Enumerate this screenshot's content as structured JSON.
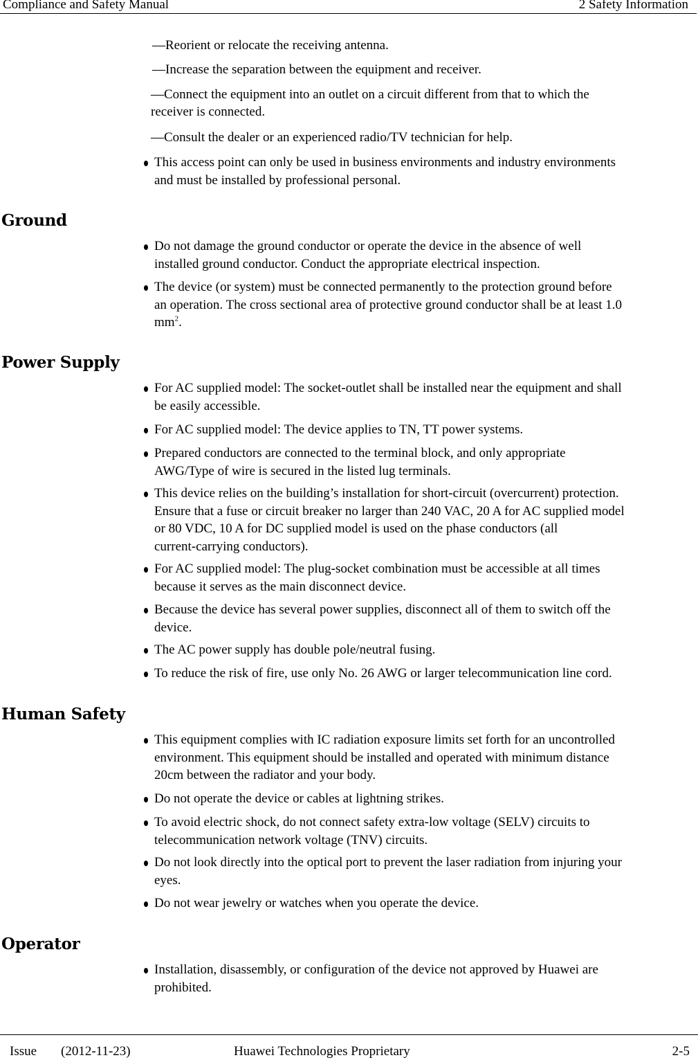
{
  "header": {
    "document_title": "Compliance and Safety Manual",
    "chapter_title": "2 Safety Information"
  },
  "continued_items": [
    {
      "dash": "—",
      "text": "Reorient or relocate the receiving antenna."
    },
    {
      "dash": "—",
      "text": "Increase the separation between the equipment and receiver."
    },
    {
      "dash": "—",
      "text": "Connect the equipment into an outlet on a circuit different from that to which the",
      "text2": "receiver is connected."
    },
    {
      "dash": "—",
      "text": "Consult the dealer or an experienced radio/TV technician for help."
    }
  ],
  "intro_bullets": [
    {
      "lines": [
        "This access point can only be used in business environments and industry environments",
        "and must be installed by professional personal."
      ]
    }
  ],
  "sections": [
    {
      "title": "Ground",
      "bullets": [
        {
          "lines": [
            "Do not damage the ground conductor or operate the device in the absence of well",
            "installed ground conductor. Conduct the appropriate electrical inspection."
          ]
        },
        {
          "lines": [
            "The device (or system) must be connected permanently to the protection ground before",
            "an operation. The cross sectional area of protective ground conductor shall be at least 1.0",
            "mm"
          ],
          "superscript": "2",
          "tail": "."
        }
      ]
    },
    {
      "title": "Power Supply",
      "bullets": [
        {
          "lines": [
            "For AC supplied model: The socket-outlet shall be installed near the equipment and shall",
            "be easily accessible."
          ]
        },
        {
          "lines": [
            "For AC supplied model: The device applies to TN, TT power systems."
          ]
        },
        {
          "lines": [
            "Prepared conductors are connected to the terminal block, and only appropriate",
            "AWG/Type of wire is secured in the listed lug terminals."
          ]
        },
        {
          "lines": [
            "This device relies on the building’s installation for short-circuit (overcurrent) protection.",
            "Ensure that a fuse or circuit breaker no larger than 240 VAC, 20 A for AC supplied model",
            "or 80 VDC, 10 A for DC supplied model is used on the phase conductors (all",
            "current-carrying conductors)."
          ]
        },
        {
          "lines": [
            "For AC supplied model: The plug-socket combination must be accessible at all times",
            "because it serves as the main disconnect device."
          ]
        },
        {
          "lines": [
            "Because the device has several power supplies, disconnect all of them to switch off the",
            "device."
          ]
        },
        {
          "lines": [
            "The AC power supply has double pole/neutral fusing."
          ]
        },
        {
          "lines": [
            "To reduce the risk of fire, use only No. 26 AWG or larger telecommunication line cord."
          ]
        }
      ]
    },
    {
      "title": "Human Safety",
      "bullets": [
        {
          "lines": [
            "This equipment complies with IC radiation exposure limits set forth for an uncontrolled",
            "environment. This equipment should be installed and operated with minimum distance",
            "20cm between the radiator and your body."
          ]
        },
        {
          "lines": [
            "Do not operate the device or cables at lightning strikes."
          ]
        },
        {
          "lines": [
            "To avoid electric shock, do not connect safety extra-low voltage (SELV) circuits to",
            "telecommunication network voltage (TNV) circuits."
          ]
        },
        {
          "lines": [
            "Do not look directly into the optical port to prevent the laser radiation from injuring your",
            "eyes."
          ]
        },
        {
          "lines": [
            "Do not wear jewelry or watches when you operate the device."
          ]
        }
      ]
    },
    {
      "title": "Operator",
      "bullets": [
        {
          "lines": [
            "Installation, disassembly, or configuration of the device not approved by Huawei are",
            "prohibited."
          ]
        }
      ]
    }
  ],
  "footer": {
    "issue_label": "Issue",
    "issue_date": "(2012-11-23)",
    "proprietary": "Huawei Technologies Proprietary",
    "page_number": "2-5"
  }
}
